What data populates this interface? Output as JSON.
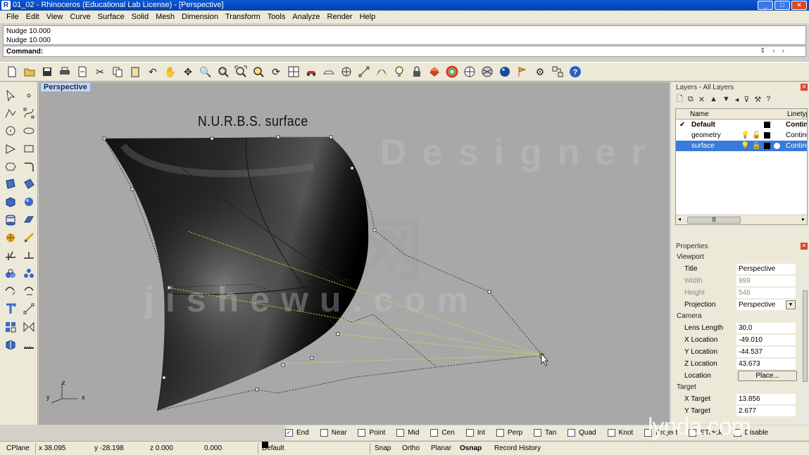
{
  "window": {
    "title": "01_02 - Rhinoceros (Educational Lab License) - [Perspective]"
  },
  "menu": [
    "File",
    "Edit",
    "View",
    "Curve",
    "Surface",
    "Solid",
    "Mesh",
    "Dimension",
    "Transform",
    "Tools",
    "Analyze",
    "Render",
    "Help"
  ],
  "command": {
    "history": [
      "Nudge 10.000",
      "Nudge 10.000"
    ],
    "prompt": "Command:"
  },
  "viewport": {
    "tab": "Perspective",
    "label": "N.U.R.B.S. surface",
    "axis_z": "z",
    "axis_y": "y",
    "axis_x": "x"
  },
  "watermarks": {
    "top": "Designer",
    "middle": "jishewu.com",
    "cn": "设计网"
  },
  "layers": {
    "title": "Layers - All Layers",
    "columns": [
      "Name",
      "Linetype"
    ],
    "rows": [
      {
        "name": "Default",
        "linetype": "Contin",
        "current": true,
        "color": "#000000"
      },
      {
        "name": "geometry",
        "linetype": "Continu",
        "current": false,
        "color": "#000000"
      },
      {
        "name": "surface",
        "linetype": "Continu",
        "current": false,
        "color": "#ffffff",
        "selected": true
      }
    ]
  },
  "properties": {
    "title": "Properties",
    "section": "Viewport",
    "viewport": [
      {
        "key": "Title",
        "value": "Perspective",
        "disabled": false
      },
      {
        "key": "Width",
        "value": "999",
        "disabled": true
      },
      {
        "key": "Height",
        "value": "546",
        "disabled": true
      },
      {
        "key": "Projection",
        "value": "Perspective",
        "disabled": false
      }
    ],
    "camera_label": "Camera",
    "camera": [
      {
        "key": "Lens Length",
        "value": "30.0"
      },
      {
        "key": "X Location",
        "value": "-49.010"
      },
      {
        "key": "Y Location",
        "value": "-44.537"
      },
      {
        "key": "Z Location",
        "value": "43.673"
      }
    ],
    "location_key": "Location",
    "place_button": "Place...",
    "target_label": "Target",
    "target": [
      {
        "key": "X Target",
        "value": "13.856"
      },
      {
        "key": "Y Target",
        "value": "2.677"
      }
    ]
  },
  "osnap": [
    {
      "label": "End",
      "checked": true
    },
    {
      "label": "Near",
      "checked": false
    },
    {
      "label": "Point",
      "checked": false
    },
    {
      "label": "Mid",
      "checked": false
    },
    {
      "label": "Cen",
      "checked": false
    },
    {
      "label": "Int",
      "checked": false
    },
    {
      "label": "Perp",
      "checked": false
    },
    {
      "label": "Tan",
      "checked": false
    },
    {
      "label": "Quad",
      "checked": false
    },
    {
      "label": "Knot",
      "checked": false
    },
    {
      "label": "Project",
      "checked": false
    },
    {
      "label": "STrack",
      "checked": false
    },
    {
      "label": "Disable",
      "checked": false
    }
  ],
  "status": {
    "cplane": "CPlane",
    "x": "x 38.095",
    "y": "y -28.198",
    "z": "z 0.000",
    "dist": "0.000",
    "layer": "Default",
    "snap": "Snap",
    "ortho": "Ortho",
    "planar": "Planar",
    "osnap": "Osnap",
    "record": "Record History"
  },
  "branding": "lynda.com",
  "colors": {
    "title_bar": "#0a58d8",
    "viewport_bg": "#a8a8a8",
    "selected_row": "#3a7ad8",
    "control_polygon": "#e0e040"
  }
}
